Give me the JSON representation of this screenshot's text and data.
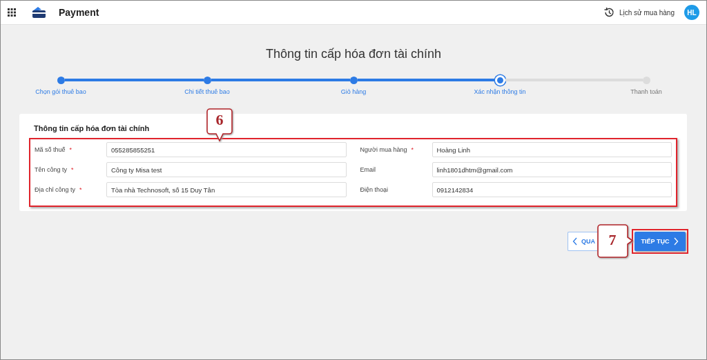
{
  "header": {
    "title": "Payment",
    "history_link": "Lịch sử mua hàng",
    "avatar": "HL"
  },
  "page_title": "Thông tin cấp hóa đơn tài chính",
  "steps": [
    {
      "label": "Chọn gói thuê bao",
      "completed": true,
      "selected": false
    },
    {
      "label": "Chi tiết thuê bao",
      "completed": true,
      "selected": false
    },
    {
      "label": "Giỏ hàng",
      "completed": true,
      "selected": false
    },
    {
      "label": "Xác nhận thông tin",
      "completed": false,
      "selected": true
    },
    {
      "label": "Thanh toán",
      "completed": false,
      "selected": false
    }
  ],
  "card": {
    "title": "Thông tin cấp hóa đơn tài chính",
    "left_fields": [
      {
        "label": "Mã số thuế",
        "required_mark": "*",
        "value": "055285855251"
      },
      {
        "label": "Tên công ty",
        "required_mark": "*",
        "value": "Công ty Misa test"
      },
      {
        "label": "Địa chỉ công ty",
        "required_mark": "*",
        "value": "Tòa nhà Technosoft, số 15 Duy Tân"
      }
    ],
    "right_fields": [
      {
        "label": "Người mua hàng",
        "required_mark": "*",
        "value": "Hoàng Linh"
      },
      {
        "label": "Email",
        "value": "linh1801dhtm@gmail.com"
      },
      {
        "label": "Điện thoại",
        "value": "0912142834"
      }
    ]
  },
  "buttons": {
    "back": "QUA",
    "next": "TIẾP TỤC"
  },
  "annotations": [
    {
      "label": "6"
    },
    {
      "label": "7"
    }
  ]
}
